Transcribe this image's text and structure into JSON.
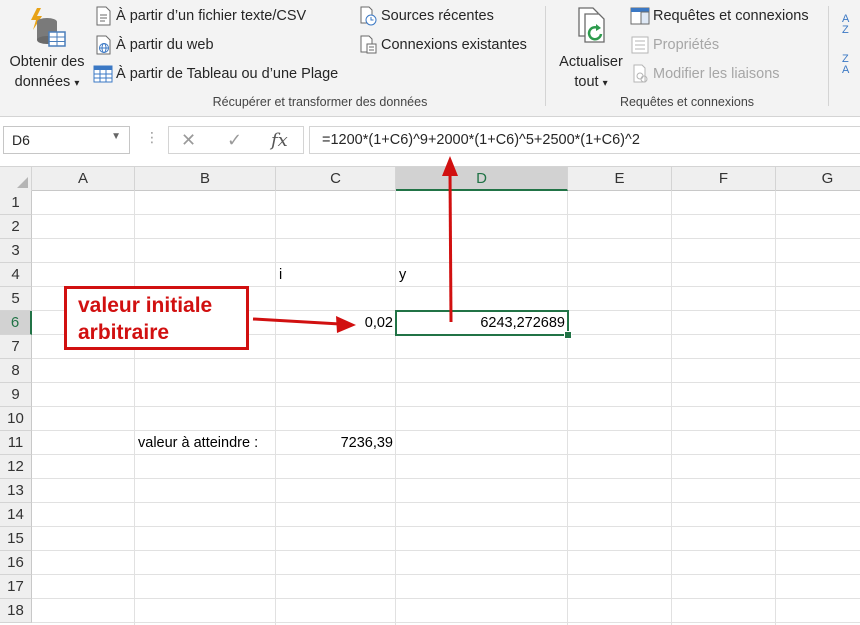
{
  "ribbon": {
    "get_data": {
      "line1": "Obtenir des",
      "line2": "données",
      "caret": "▾"
    },
    "from_text_csv": "À partir d’un fichier texte/CSV",
    "from_web": "À partir du web",
    "from_table": "À partir de Tableau ou d’une Plage",
    "recent_sources": "Sources récentes",
    "existing_connections": "Connexions existantes",
    "group1_label": "Récupérer et transformer des données",
    "refresh_all": {
      "line1": "Actualiser",
      "line2": "tout",
      "caret": "▾"
    },
    "queries_connections": "Requêtes et connexions",
    "properties": "Propriétés",
    "edit_links": "Modifier les liaisons",
    "group2_label": "Requêtes et connexions",
    "sort_az_top": "A",
    "sort_az_bottom": "Z",
    "sort_za_top": "Z",
    "sort_za_bottom": "A"
  },
  "formula_bar": {
    "name_box": "D6",
    "cancel_glyph": "✕",
    "enter_glyph": "✓",
    "fx_glyph": "fx",
    "formula": "=1200*(1+C6)^9+2000*(1+C6)^5+2500*(1+C6)^2"
  },
  "columns": [
    "A",
    "B",
    "C",
    "D",
    "E",
    "F",
    "G"
  ],
  "rows": [
    "1",
    "2",
    "3",
    "4",
    "5",
    "6",
    "7",
    "8",
    "9",
    "10",
    "11",
    "12",
    "13",
    "14",
    "15",
    "16",
    "17",
    "18"
  ],
  "selected_cell": "D6",
  "cells": {
    "C4": "i",
    "D4": "y",
    "C6": "0,02",
    "D6": "6243,272689",
    "B11": "valeur à atteindre :",
    "C11": "7236,39"
  },
  "annotation": {
    "line1": "valeur initiale",
    "line2": "arbitraire"
  },
  "colors": {
    "excel_green": "#217346",
    "annotation_red": "#d11010"
  }
}
